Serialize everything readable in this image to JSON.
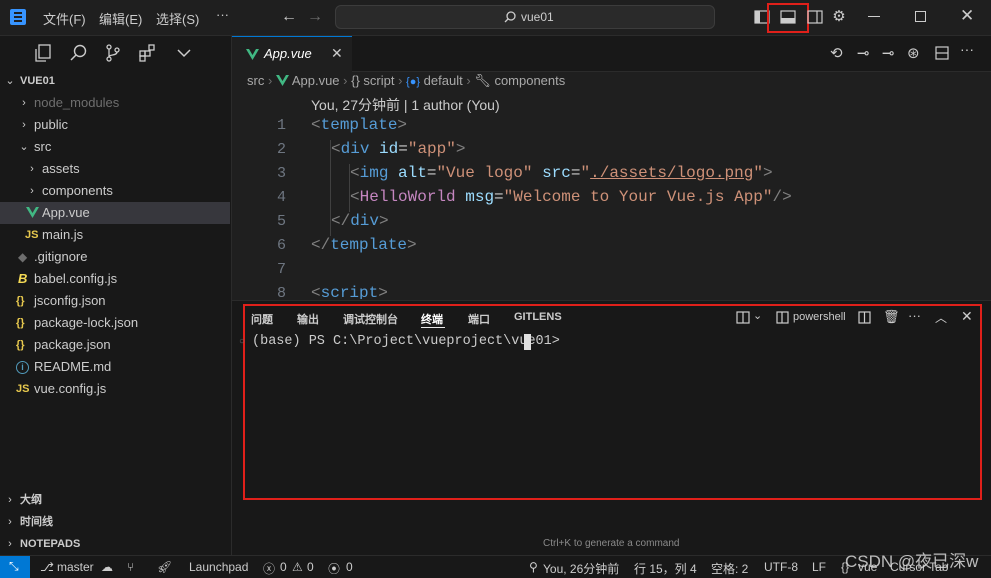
{
  "titlebar": {
    "menus": [
      "文件(F)",
      "编辑(E)",
      "选择(S)",
      "···"
    ],
    "search": "vue01"
  },
  "sidebar": {
    "root": "VUE01",
    "items": [
      {
        "label": "node_modules",
        "type": "folder",
        "indent": 1,
        "open": false,
        "dim": true
      },
      {
        "label": "public",
        "type": "folder",
        "indent": 1,
        "open": false
      },
      {
        "label": "src",
        "type": "folder",
        "indent": 1,
        "open": true
      },
      {
        "label": "assets",
        "type": "folder",
        "indent": 2,
        "open": false
      },
      {
        "label": "components",
        "type": "folder",
        "indent": 2,
        "open": false
      },
      {
        "label": "App.vue",
        "type": "vue",
        "indent": 2,
        "selected": true
      },
      {
        "label": "main.js",
        "type": "js",
        "indent": 2
      },
      {
        "label": ".gitignore",
        "type": "git",
        "indent": 1
      },
      {
        "label": "babel.config.js",
        "type": "babel",
        "indent": 1
      },
      {
        "label": "jsconfig.json",
        "type": "json",
        "indent": 1
      },
      {
        "label": "package-lock.json",
        "type": "json",
        "indent": 1
      },
      {
        "label": "package.json",
        "type": "json",
        "indent": 1
      },
      {
        "label": "README.md",
        "type": "info",
        "indent": 1
      },
      {
        "label": "vue.config.js",
        "type": "js",
        "indent": 1
      }
    ],
    "sections": [
      "大纲",
      "时间线",
      "NOTEPADS"
    ]
  },
  "editor": {
    "tab": "App.vue",
    "breadcrumb": [
      "src",
      "App.vue",
      "{} script",
      "default",
      "components"
    ],
    "blame": "You, 27分钟前 | 1 author (You)",
    "line_numbers": [
      "1",
      "2",
      "3",
      "4",
      "5",
      "6",
      "7",
      "8"
    ]
  },
  "panel": {
    "tabs": [
      "问题",
      "输出",
      "调试控制台",
      "终端",
      "端口",
      "GITLENS"
    ],
    "active_tab": "终端",
    "shell": "powershell",
    "prompt": "(base) PS C:\\Project\\vueproject\\vue01>",
    "hint": "Ctrl+K to generate a command"
  },
  "statusbar": {
    "branch": "master",
    "launchpad": "Launchpad",
    "errors": "0",
    "warnings": "0",
    "ports": "0",
    "blame": "You, 26分钟前",
    "position": "行 15，列 4",
    "spaces": "空格: 2",
    "encoding": "UTF-8",
    "eol": "LF",
    "language": "vue",
    "cursor": "Cursor Tab"
  },
  "watermark": "CSDN @夜已深w"
}
